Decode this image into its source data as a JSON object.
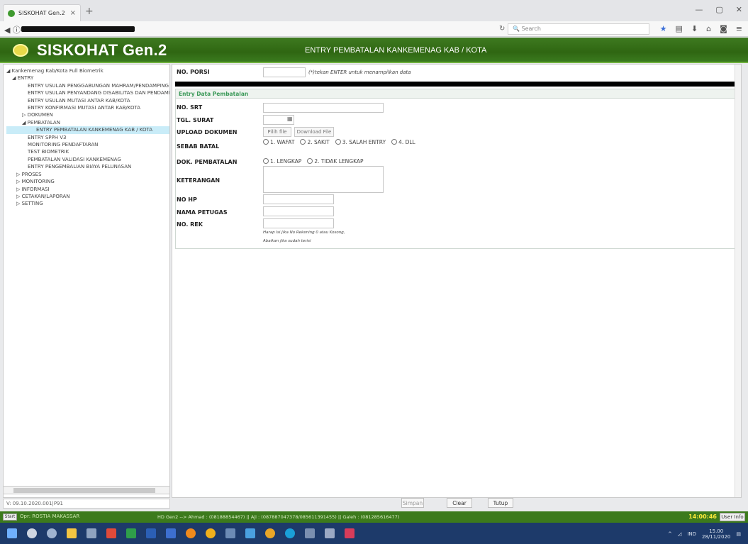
{
  "browser": {
    "tab_title": "SISKOHAT Gen.2",
    "search_placeholder": "Search",
    "tab_close": "×",
    "new_tab": "+"
  },
  "header": {
    "app_title": "SISKOHAT Gen.2",
    "page_title": "ENTRY PEMBATALAN KANKEMENAG KAB / KOTA"
  },
  "sidebar": {
    "items": [
      "◢ Kankemenag Kab/Kota Full Biometrik",
      "◢ ENTRY",
      "ENTRY USULAN PENGGABUNGAN MAHRAM/PENDAMPING LANS",
      "ENTRY USULAN PENYANDANG DISABILITAS DAN PENDAMPING",
      "ENTRY USULAN MUTASI ANTAR KAB/KOTA",
      "ENTRY KONFIRMASI MUTASI ANTAR KAB/KOTA",
      "▷ DOKUMEN",
      "◢ PEMBATALAN",
      "ENTRY PEMBATALAN KANKEMENAG KAB / KOTA",
      "ENTRY SPPH V3",
      "MONITORING PENDAFTARAN",
      "TEST BIOMETRIK",
      "PEMBATALAN VALIDASI KANKEMENAG",
      "ENTRY PENGEMBALIAN BIAYA PELUNASAN",
      "▷ PROSES",
      "▷ MONITORING",
      "▷ INFORMASI",
      "▷ CETAKAN/LAPORAN",
      "▷ SETTING"
    ],
    "version": "V: 09.10.2020.001|P91"
  },
  "form": {
    "no_porsi_label": "NO. PORSI",
    "no_porsi_hint": "(*)tekan ENTER untuk menampilkan data",
    "section_title": "Entry Data Pembatalan",
    "no_srt_label": "NO. SRT",
    "tgl_surat_label": "TGL. SURAT",
    "upload_label": "UPLOAD DOKUMEN",
    "pilih_file": "Pilih file",
    "download_file": "Download File",
    "sebab_label": "SEBAB BATAL",
    "sebab_options": [
      "1. WAFAT",
      "2. SAKIT",
      "3. SALAH ENTRY",
      "4. DLL"
    ],
    "dok_label": "DOK. PEMBATALAN",
    "dok_options": [
      "1. LENGKAP",
      "2. TIDAK LENGKAP"
    ],
    "keterangan_label": "KETERANGAN",
    "no_hp_label": "NO HP",
    "nama_petugas_label": "NAMA PETUGAS",
    "no_rek_label": "NO. REK",
    "note1": "Harap Isi Jika No Rekening 0 atau Kosong,",
    "note2": "Abaikan jika sudah terisi"
  },
  "buttons": {
    "simpan": "Simpan",
    "clear": "Clear",
    "tutup": "Tutup"
  },
  "statusbar": {
    "start": "Start",
    "operator": "Opr: ROSTIA MAKASSAR",
    "helpdesk": "HD Gen2 --> Ahmad : (08188854467) || Aji : (087887047378/085611391455) || Galeh : (081285616477)",
    "time": "14:00:46",
    "user_info": "User Info"
  },
  "taskbar": {
    "tray_lang": "IND",
    "tray_time": "15.00",
    "tray_date": "28/11/2020"
  }
}
